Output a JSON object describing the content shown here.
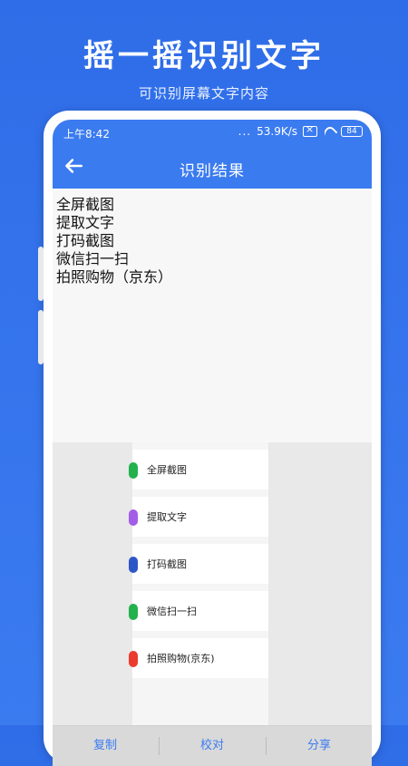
{
  "promo": {
    "headline": "摇一摇识别文字",
    "subline": "可识别屏幕文字内容"
  },
  "status_bar": {
    "time": "上午8:42",
    "dots": "...",
    "speed": "53.9K/s",
    "battery": "84",
    "icons": [
      "x-box-icon",
      "wifi-icon",
      "battery-icon"
    ]
  },
  "app_bar": {
    "title": "识别结果",
    "back_icon": "arrow-left-icon"
  },
  "result": {
    "lines": [
      "全屏截图",
      "提取文字",
      "打码截图",
      "微信扫一扫",
      "拍照购物（京东）"
    ]
  },
  "preview": {
    "items": [
      {
        "label": "全屏截图",
        "color": "#22b14c"
      },
      {
        "label": "提取文字",
        "color": "#a45de6"
      },
      {
        "label": "打码截图",
        "color": "#2f56c6"
      },
      {
        "label": "微信扫一扫",
        "color": "#22b14c"
      },
      {
        "label": "拍照购物(京东)",
        "color": "#ea3b2f"
      }
    ]
  },
  "bottom_bar": {
    "copy_label": "复制",
    "proof_label": "校对",
    "share_label": "分享"
  },
  "colors": {
    "primary": "#3b7bf0",
    "background": "#2f6de8"
  }
}
